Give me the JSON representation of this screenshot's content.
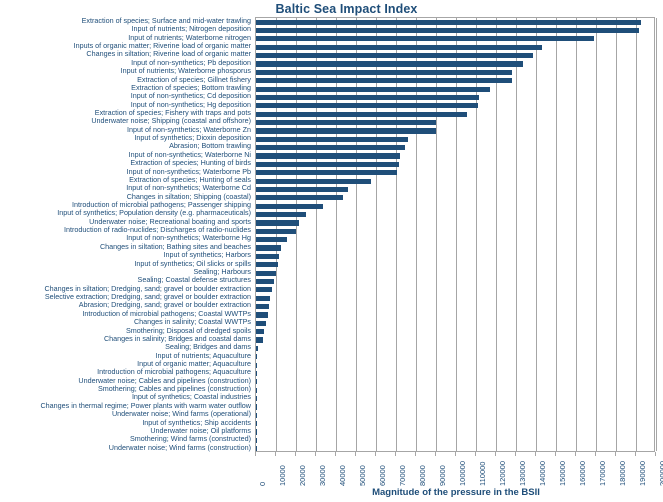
{
  "chart_data": {
    "type": "bar",
    "orientation": "horizontal",
    "title": "Baltic Sea Impact Index",
    "xlabel": "Magnitude of the pressure in the BSII",
    "ylabel": "",
    "xlim": [
      0,
      200000
    ],
    "xticks": [
      0,
      10000,
      20000,
      30000,
      40000,
      50000,
      60000,
      70000,
      80000,
      90000,
      100000,
      110000,
      120000,
      130000,
      140000,
      150000,
      160000,
      170000,
      180000,
      190000,
      200000
    ],
    "xtick_labels": [
      "0",
      "10000",
      "20000",
      "30000",
      "40000",
      "50000",
      "60000",
      "70000",
      "80000",
      "90000",
      "100000",
      "110000",
      "120000",
      "130000",
      "140000",
      "150000",
      "160000",
      "170000",
      "180000",
      "190000",
      "200000"
    ],
    "grid": true,
    "grid_axis": "x",
    "legend": false,
    "bar_color": "#1F4E79",
    "categories": [
      "Extraction of species; Surface and mid-water trawling",
      "Input of nutrients; Nitrogen deposition",
      "Input of nutrients; Waterborne nitrogen",
      "Inputs of organic matter; Riverine load of organic matter",
      "Changes in siltation; Riverine load of organic matter",
      "Input of non-synthetics; Pb deposition",
      "Input of nutrients; Waterborne phosporus",
      "Extraction of species; Gillnet fishery",
      "Extraction of species; Bottom trawling",
      "Input of non-synthetics; Cd deposition",
      "Input of non-synthetics; Hg deposition",
      "Extraction of species; Fishery with traps and pots",
      "Underwater noise; Shipping (coastal and offshore)",
      "Input of non-synthetics; Waterborne Zn",
      "Input of synthetics; Dioxin deposition",
      "Abrasion; Bottom trawling",
      "Input of non-synthetics; Waterborne Ni",
      "Extraction of species; Hunting of birds",
      "Input of non-synthetics; Waterborne Pb",
      "Extraction of species; Hunting of seals",
      "Input of non-synthetics; Waterborne Cd",
      "Changes in siltation; Shipping (coastal)",
      "Introduction of microbial pathogens; Passenger shipping",
      "Input of synthetics; Population density (e.g. pharmaceuticals)",
      "Underwater noise; Recreational boating and sports",
      "Introduction of radio-nuclides; Discharges of radio-nuclides",
      "Input of non-synthetics; Waterborne Hg",
      "Changes in siltation; Bathing sites and beaches",
      "Input of synthetics; Harbors",
      "Input of synthetics; Oil slicks or spills",
      "Sealing; Harbours",
      "Sealing; Coastal defense structures",
      "Changes in siltation; Dredging, sand; gravel or boulder extraction",
      "Selective extraction; Dredging, sand; gravel or boulder extraction",
      "Abrasion; Dredging, sand; gravel or boulder extraction",
      "Introduction of microbial pathogens; Coastal WWTPs",
      "Changes in salinity; Coastal WWTPs",
      "Smothering; Disposal of dredged spoils",
      "Changes in salinity; Bridges and coastal dams",
      "Sealing; Bridges and dams",
      "Input of nutrients; Aquaculture",
      "Input of organic matter; Aquaculture",
      "Introduction of microbial pathogens; Aquaculture",
      "Underwater noise; Cables and pipelines (construction)",
      "Smothering; Cables and pipelines (construction)",
      "Input of synthetics; Coastal industries",
      "Changes in thermal regime; Power plants with warm water outflow",
      "Underwater noise; Wind farms (operational)",
      "Input of synthetics; Ship accidents",
      "Underwater noise; Oil platforms",
      "Smothering; Wind farms (constructed)",
      "Underwater noise; Wind farms (construction)"
    ],
    "values": [
      192500,
      191500,
      169000,
      143000,
      138500,
      133500,
      128000,
      128000,
      117000,
      111500,
      111000,
      105500,
      90000,
      90000,
      76000,
      74500,
      72000,
      71500,
      70500,
      57500,
      46000,
      43500,
      33500,
      25000,
      21500,
      20000,
      15500,
      12500,
      11500,
      11000,
      10000,
      9000,
      8000,
      7000,
      6500,
      6000,
      5000,
      4200,
      3500,
      900,
      700,
      600,
      500,
      450,
      400,
      350,
      300,
      250,
      200,
      150,
      120,
      100
    ]
  }
}
